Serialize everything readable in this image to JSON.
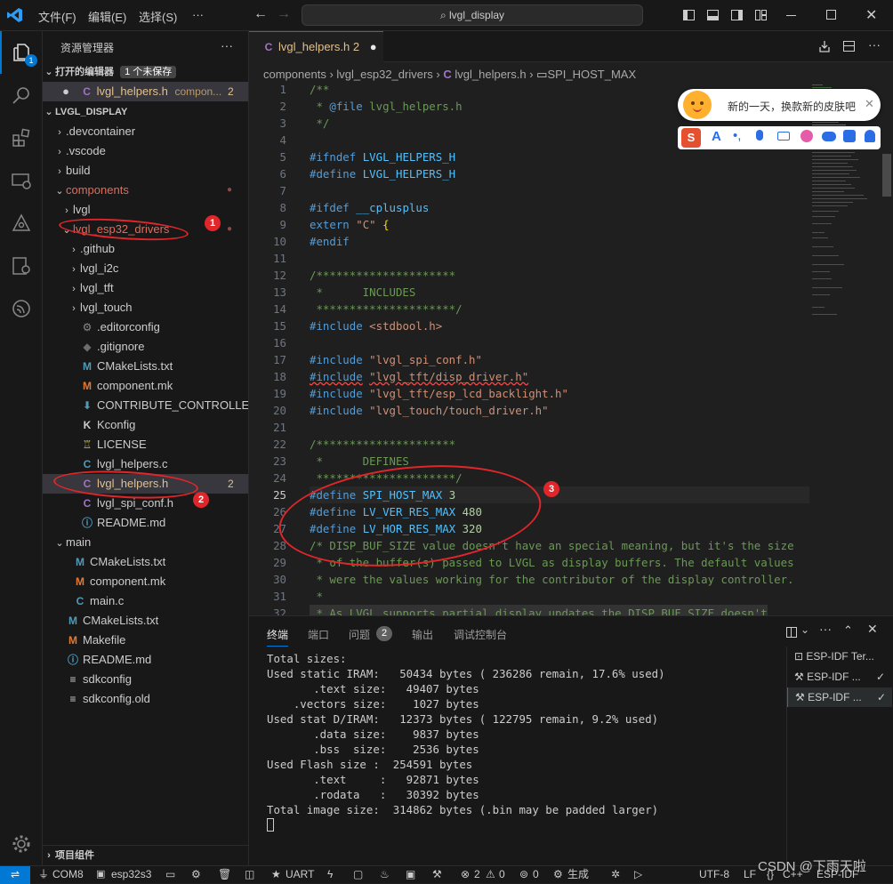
{
  "titlebar": {
    "menu": [
      "文件(F)",
      "编辑(E)",
      "选择(S)",
      "···"
    ],
    "search": "lvgl_display"
  },
  "sidebar": {
    "title": "资源管理器",
    "more": "···",
    "open_editors": {
      "label": "打开的编辑器",
      "badge": "1 个未保存",
      "file": "lvgl_helpers.h",
      "path": "compon...",
      "count": "2"
    },
    "root": "LVGL_DISPLAY",
    "tree": [
      {
        "label": ".devcontainer",
        "kind": "folder",
        "depth": 1
      },
      {
        "label": ".vscode",
        "kind": "folder",
        "depth": 1
      },
      {
        "label": "build",
        "kind": "folder",
        "depth": 1
      },
      {
        "label": "components",
        "kind": "folder-open",
        "depth": 1,
        "dot": true
      },
      {
        "label": "lvgl",
        "kind": "folder",
        "depth": 2
      },
      {
        "label": "lvgl_esp32_drivers",
        "kind": "folder-open",
        "depth": 2,
        "dot": true
      },
      {
        "label": ".github",
        "kind": "folder",
        "depth": 3
      },
      {
        "label": "lvgl_i2c",
        "kind": "folder",
        "depth": 3
      },
      {
        "label": "lvgl_tft",
        "kind": "folder",
        "depth": 3
      },
      {
        "label": "lvgl_touch",
        "kind": "folder",
        "depth": 3
      },
      {
        "label": ".editorconfig",
        "kind": "gear",
        "depth": 3
      },
      {
        "label": ".gitignore",
        "kind": "git",
        "depth": 3
      },
      {
        "label": "CMakeLists.txt",
        "kind": "M",
        "depth": 3
      },
      {
        "label": "component.mk",
        "kind": "Mk",
        "depth": 3
      },
      {
        "label": "CONTRIBUTE_CONTROLLER_S...",
        "kind": "down",
        "depth": 3
      },
      {
        "label": "Kconfig",
        "kind": "K",
        "depth": 3
      },
      {
        "label": "LICENSE",
        "kind": "lic",
        "depth": 3
      },
      {
        "label": "lvgl_helpers.c",
        "kind": "C",
        "depth": 3
      },
      {
        "label": "lvgl_helpers.h",
        "kind": "Ch",
        "depth": 3,
        "count": "2",
        "selected": true
      },
      {
        "label": "lvgl_spi_conf.h",
        "kind": "Ch",
        "depth": 3
      },
      {
        "label": "README.md",
        "kind": "info",
        "depth": 3
      },
      {
        "label": "main",
        "kind": "folder-open",
        "depth": 1
      },
      {
        "label": "CMakeLists.txt",
        "kind": "M",
        "depth": 2
      },
      {
        "label": "component.mk",
        "kind": "Mk",
        "depth": 2
      },
      {
        "label": "main.c",
        "kind": "C",
        "depth": 2
      },
      {
        "label": "CMakeLists.txt",
        "kind": "M",
        "depth": 1
      },
      {
        "label": "Makefile",
        "kind": "Mk",
        "depth": 1
      },
      {
        "label": "README.md",
        "kind": "info",
        "depth": 1
      },
      {
        "label": "sdkconfig",
        "kind": "lines",
        "depth": 1
      },
      {
        "label": "sdkconfig.old",
        "kind": "lines",
        "depth": 1
      }
    ],
    "outline": "项目组件"
  },
  "editor": {
    "tab": {
      "label": "lvgl_helpers.h",
      "count": "2"
    },
    "breadcrumbs": [
      "components",
      "lvgl_esp32_drivers",
      "lvgl_helpers.h",
      "SPI_HOST_MAX"
    ],
    "lines": [
      [
        "1",
        "/**",
        "cmt"
      ],
      [
        "2",
        " * @file lvgl_helpers.h",
        "cmt"
      ],
      [
        "3",
        " */",
        "cmt"
      ],
      [
        "4",
        "",
        ""
      ],
      [
        "5",
        "#ifndef LVGL_HELPERS_H",
        "pp"
      ],
      [
        "6",
        "#define LVGL_HELPERS_H",
        "pp"
      ],
      [
        "7",
        "",
        ""
      ],
      [
        "8",
        "#ifdef __cplusplus",
        "pp"
      ],
      [
        "9",
        "extern \"C\" {",
        "ext"
      ],
      [
        "10",
        "#endif",
        "pp"
      ],
      [
        "11",
        "",
        ""
      ],
      [
        "12",
        "/*********************",
        "cmt"
      ],
      [
        "13",
        " *      INCLUDES",
        "cmt"
      ],
      [
        "14",
        " *********************/",
        "cmt"
      ],
      [
        "15",
        "#include <stdbool.h>",
        "inc"
      ],
      [
        "16",
        "",
        ""
      ],
      [
        "17",
        "#include \"lvgl_spi_conf.h\"",
        "inc"
      ],
      [
        "18",
        "#include \"lvgl_tft/disp_driver.h\"",
        "inc"
      ],
      [
        "19",
        "#include \"lvgl_tft/esp_lcd_backlight.h\"",
        "inc"
      ],
      [
        "20",
        "#include \"lvgl_touch/touch_driver.h\"",
        "inc"
      ],
      [
        "21",
        "",
        ""
      ],
      [
        "22",
        "/*********************",
        "cmt"
      ],
      [
        "23",
        " *      DEFINES",
        "cmt"
      ],
      [
        "24",
        " *********************/",
        "cmt"
      ],
      [
        "25",
        "#define SPI_HOST_MAX 3",
        "def"
      ],
      [
        "26",
        "#define LV_VER_RES_MAX 480",
        "def"
      ],
      [
        "27",
        "#define LV_HOR_RES_MAX 320",
        "def"
      ],
      [
        "28",
        "/* DISP_BUF_SIZE value doesn't have an special meaning, but it's the size",
        "cmt"
      ],
      [
        "29",
        " * of the buffer(s) passed to LVGL as display buffers. The default values",
        "cmt"
      ],
      [
        "30",
        " * were the values working for the contributor of the display controller.",
        "cmt"
      ],
      [
        "31",
        " *",
        "cmt"
      ],
      [
        "32",
        " * As LVGL supports partial display updates the DISP_BUF_SIZE doesn't",
        "cmt"
      ]
    ]
  },
  "panel": {
    "tabs": [
      "终端",
      "端口",
      "问题",
      "输出",
      "调试控制台"
    ],
    "problems_count": "2",
    "terminal": [
      "Total sizes:",
      "Used static IRAM:   50434 bytes ( 236286 remain, 17.6% used)",
      "       .text size:   49407 bytes",
      "    .vectors size:    1027 bytes",
      "Used stat D/IRAM:   12373 bytes ( 122795 remain, 9.2% used)",
      "       .data size:    9837 bytes",
      "       .bss  size:    2536 bytes",
      "Used Flash size :  254591 bytes",
      "       .text     :   92871 bytes",
      "       .rodata   :   30392 bytes",
      "Total image size:  314862 bytes (.bin may be padded larger)"
    ],
    "terminals": [
      "ESP-IDF Ter...",
      "ESP-IDF ...",
      "ESP-IDF ..."
    ]
  },
  "ime": {
    "greeting": "新的一天，换款新的皮肤吧"
  },
  "annotations": [
    "1",
    "2",
    "3"
  ],
  "status": {
    "port": "COM8",
    "target": "esp32s3",
    "uart": "UART",
    "errors": "2",
    "warnings": "0",
    "ports": "0",
    "build": "生成",
    "encoding": "UTF-8",
    "eol": "LF",
    "lang": "C++",
    "idf": "ESP-IDF",
    "watermark": "CSDN @下雨天啦"
  }
}
